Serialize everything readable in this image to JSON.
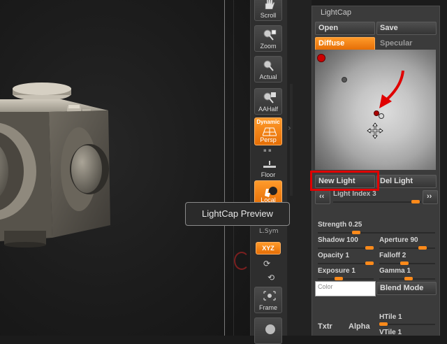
{
  "shelf": {
    "scroll": "Scroll",
    "zoom": "Zoom",
    "actual": "Actual",
    "aahalf": "AAHalf",
    "dynamic": "Dynamic",
    "persp": "Persp",
    "floor": "Floor",
    "local": "Local",
    "lsym": "L.Sym",
    "xyz": "XYZ",
    "frame": "Frame"
  },
  "tooltip": "LightCap Preview",
  "lightcap": {
    "title": "LightCap",
    "open": "Open",
    "save": "Save",
    "diffuse": "Diffuse",
    "specular": "Specular",
    "new_light": "New Light",
    "del_light": "Del Light",
    "light_index": "Light Index 3",
    "light_index_value": 3,
    "strength": "Strength 0.25",
    "strength_value": 0.25,
    "shadow": "Shadow 100",
    "shadow_value": 100,
    "aperture": "Aperture 90",
    "aperture_value": 90,
    "opacity": "Opacity 1",
    "opacity_value": 1,
    "falloff": "Falloff 2",
    "falloff_value": 2,
    "exposure": "Exposure 1",
    "exposure_value": 1,
    "gamma": "Gamma 1",
    "gamma_value": 1,
    "color": "Color",
    "blend_mode": "Blend Mode",
    "txtr": "Txtr",
    "alpha": "Alpha",
    "htile": "HTile 1",
    "htile_value": 1,
    "vtile": "VTile 1",
    "vtile_value": 1
  },
  "colors": {
    "accent": "#f07c10",
    "highlight": "#e00000",
    "panel": "#3b3b3b"
  }
}
